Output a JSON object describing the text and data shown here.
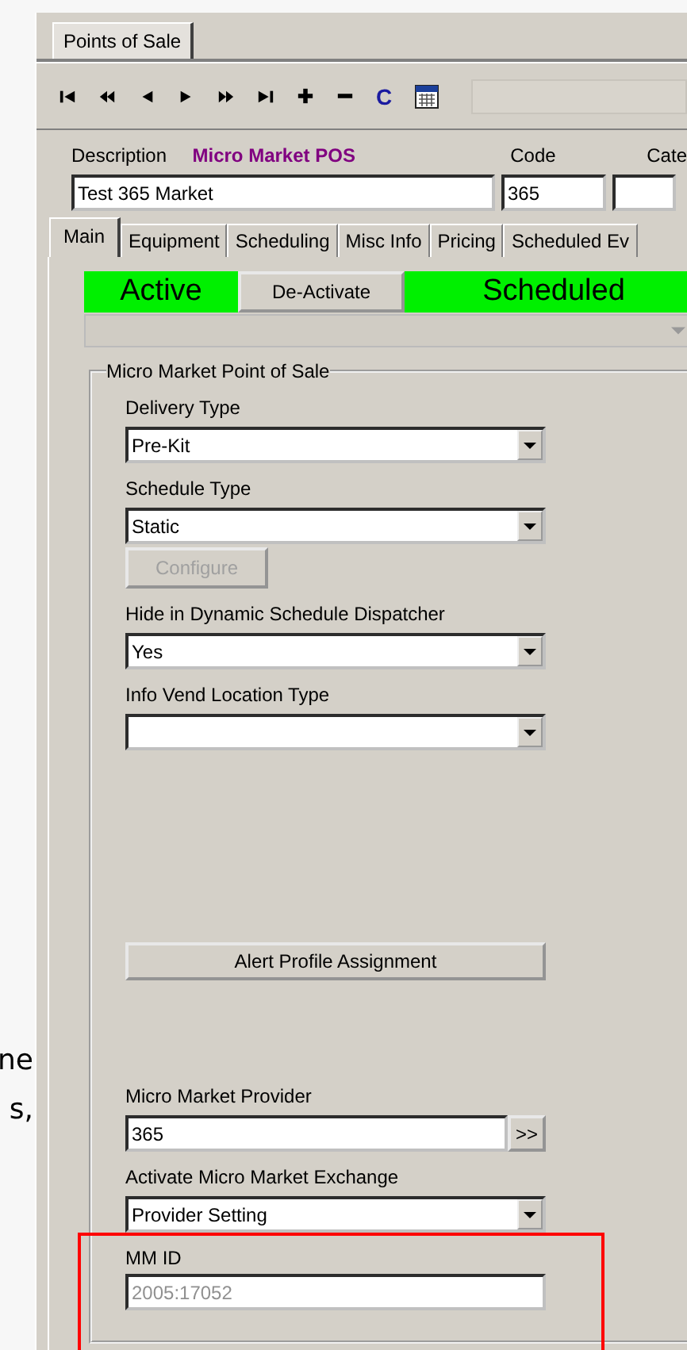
{
  "side_text": [
    "ne",
    "s,"
  ],
  "window_tab": {
    "label": "Points of Sale",
    "selected": true
  },
  "toolbar": {
    "buttons": [
      {
        "kind": "first"
      },
      {
        "kind": "fastback"
      },
      {
        "kind": "prev"
      },
      {
        "kind": "next"
      },
      {
        "kind": "fastforward"
      },
      {
        "kind": "last"
      },
      {
        "kind": "add"
      },
      {
        "kind": "remove"
      },
      {
        "kind": "letter",
        "label": "C"
      },
      {
        "kind": "calendar"
      }
    ]
  },
  "header": {
    "description_label": "Description",
    "type_label": "Micro Market POS",
    "code_label": "Code",
    "category_label": "Cate",
    "description_value": "Test 365 Market",
    "code_value": "365"
  },
  "tabs": [
    {
      "label": "Main",
      "selected": true
    },
    {
      "label": "Equipment",
      "selected": false
    },
    {
      "label": "Scheduling",
      "selected": false
    },
    {
      "label": "Misc Info",
      "selected": false
    },
    {
      "label": "Pricing",
      "selected": false
    },
    {
      "label": "Scheduled Ev",
      "selected": false
    }
  ],
  "status": {
    "active_label": "Active",
    "button": "De-Activate",
    "scheduled_label": "Scheduled"
  },
  "group": {
    "title": "Micro Market Point of Sale",
    "fields": [
      {
        "kind": "dropdown",
        "label": "Delivery Type",
        "value": "Pre-Kit"
      },
      {
        "kind": "dropdown",
        "label": "Schedule Type",
        "value": "Static"
      },
      {
        "kind": "button",
        "label": "Configure",
        "disabled": true
      },
      {
        "kind": "dropdown",
        "label": "Hide in Dynamic Schedule Dispatcher",
        "value": "Yes"
      },
      {
        "kind": "dropdown",
        "label": "Info Vend Location Type"
      }
    ],
    "alert_button": "Alert Profile Assignment",
    "lower_fields": [
      {
        "kind": "lookup",
        "label": "Micro Market Provider",
        "value": "365",
        "button": ">>"
      },
      {
        "kind": "dropdown",
        "label": "Activate Micro Market Exchange",
        "value": "Provider Setting"
      },
      {
        "kind": "text",
        "label": "MM ID",
        "value": "2005:17052",
        "disabled": true
      }
    ]
  }
}
